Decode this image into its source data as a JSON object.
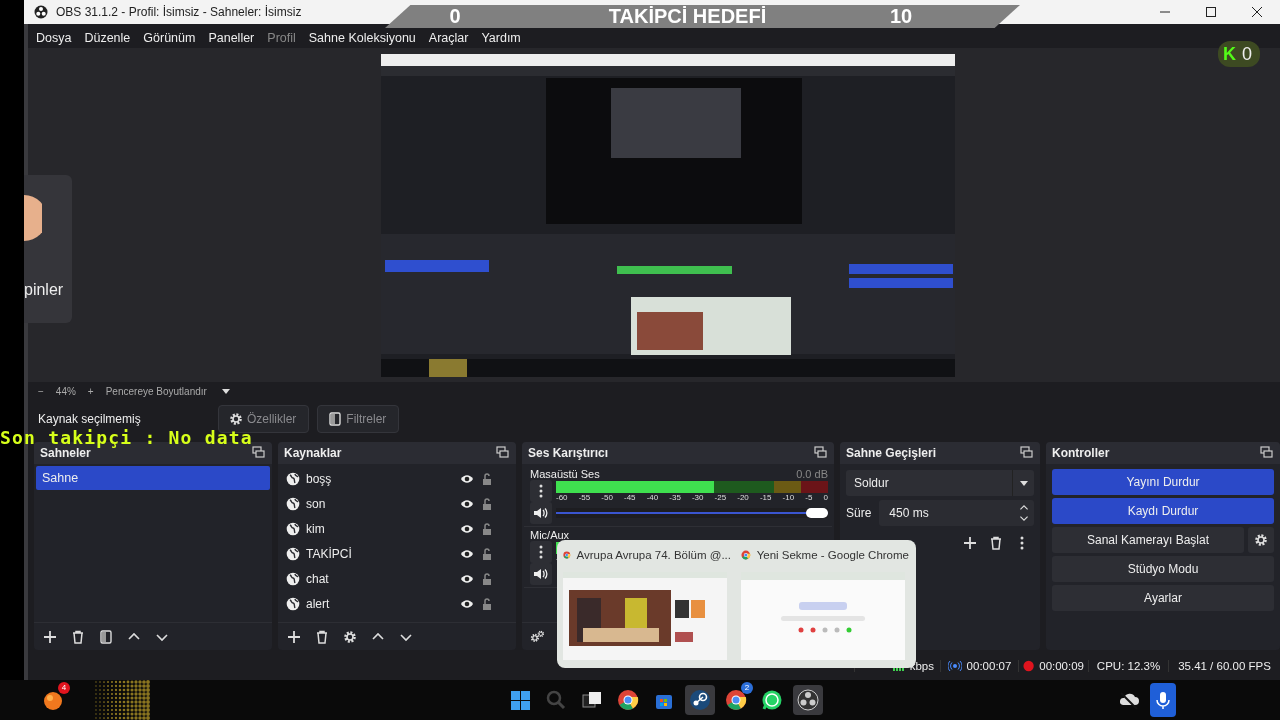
{
  "window": {
    "title": "OBS 31.1.2 - Profil: İsimsiz - Sahneler: İsimsiz"
  },
  "menu": [
    {
      "label": "Dosya",
      "disabled": false
    },
    {
      "label": "Düzenle",
      "disabled": false
    },
    {
      "label": "Görünüm",
      "disabled": false
    },
    {
      "label": "Paneller",
      "disabled": false
    },
    {
      "label": "Profil",
      "disabled": true
    },
    {
      "label": "Sahne Koleksiyonu",
      "disabled": false
    },
    {
      "label": "Araçlar",
      "disabled": false
    },
    {
      "label": "Yardım",
      "disabled": false
    }
  ],
  "zoom_bar": {
    "minus": "−",
    "zoom": "44%",
    "plus": "+",
    "fit": "Pencereye Boyutlandır"
  },
  "source_bar": {
    "status": "Kaynak seçilmemiş",
    "buttons": [
      {
        "kind": "properties",
        "label": "Özellikler",
        "disabled": true
      },
      {
        "kind": "filters",
        "label": "Filtreler",
        "disabled": true
      }
    ]
  },
  "scenes": {
    "title": "Sahneler",
    "items": [
      {
        "label": "Sahne",
        "selected": true
      }
    ]
  },
  "sources": {
    "title": "Kaynaklar",
    "items": [
      {
        "label": "boşş",
        "visible": true,
        "locked": false
      },
      {
        "label": "son",
        "visible": true,
        "locked": false
      },
      {
        "label": "kim",
        "visible": true,
        "locked": false
      },
      {
        "label": "TAKİPCİ",
        "visible": true,
        "locked": false
      },
      {
        "label": "chat",
        "visible": true,
        "locked": false
      },
      {
        "label": "alert",
        "visible": true,
        "locked": false
      }
    ]
  },
  "mixer": {
    "title": "Ses Karıştırıcı",
    "scale": [
      "-60",
      "-55",
      "-50",
      "-45",
      "-40",
      "-35",
      "-30",
      "-25",
      "-20",
      "-15",
      "-10",
      "-5",
      "0"
    ],
    "channels": [
      {
        "name": "Masaüstü Ses",
        "reading": "0.0 dB",
        "level": 0.58,
        "volume": {
          "level": 1
        }
      },
      {
        "name": "Mic/Aux",
        "level": 0.03
      }
    ]
  },
  "transitions": {
    "title": "Sahne Geçişleri",
    "transition": "Soldur",
    "duration_label": "Süre",
    "duration": "450 ms"
  },
  "controls": {
    "title": "Kontroller",
    "buttons": [
      {
        "label": "Yayını Durdur",
        "kind": "plain",
        "active": true
      },
      {
        "label": "Kaydı Durdur",
        "kind": "plain",
        "active": true
      },
      {
        "label": "Sanal Kamerayı Başlat",
        "kind": "with-settings",
        "active": false
      },
      {
        "label": "Stüdyo Modu",
        "kind": "plain",
        "active": false
      },
      {
        "label": "Ayarlar",
        "kind": "plain",
        "active": false
      }
    ]
  },
  "status_bar": {
    "bitrate": "kbps",
    "stream_time": "00:00:07",
    "record_time": "00:00:09",
    "cpu": "CPU: 12.3%",
    "fps": "35.41 / 60.00 FPS"
  },
  "overlays": {
    "goal": {
      "current": "0",
      "title": "TAKİPCİ HEDEFİ",
      "target": "10"
    },
    "last_follower": "Son takipçi : No data",
    "kick_badge": {
      "letter": "K",
      "count": "0"
    },
    "side_card": {
      "text": "pinler"
    }
  },
  "taskbar_preview": {
    "windows": [
      {
        "title": "Avrupa Avrupa 74. Bölüm @...",
        "kind": "picture"
      },
      {
        "title": "Yeni Sekme - Google Chrome",
        "kind": "picture"
      }
    ]
  },
  "taskbar": {
    "left": [
      {
        "kind": "orange-app",
        "badge": "4"
      },
      {
        "kind": "widget"
      }
    ],
    "apps": [
      {
        "kind": "windows",
        "selected": false
      },
      {
        "kind": "search",
        "selected": false
      },
      {
        "kind": "taskview",
        "selected": false
      },
      {
        "kind": "chrome",
        "selected": false
      },
      {
        "kind": "store",
        "selected": false
      },
      {
        "kind": "steam",
        "selected": true
      },
      {
        "kind": "chrome",
        "badge": "2",
        "selected": false
      },
      {
        "kind": "whatsapp",
        "selected": false
      },
      {
        "kind": "obs",
        "selected": true
      }
    ],
    "tray": [
      {
        "kind": "cloud"
      },
      {
        "kind": "mic"
      }
    ]
  }
}
